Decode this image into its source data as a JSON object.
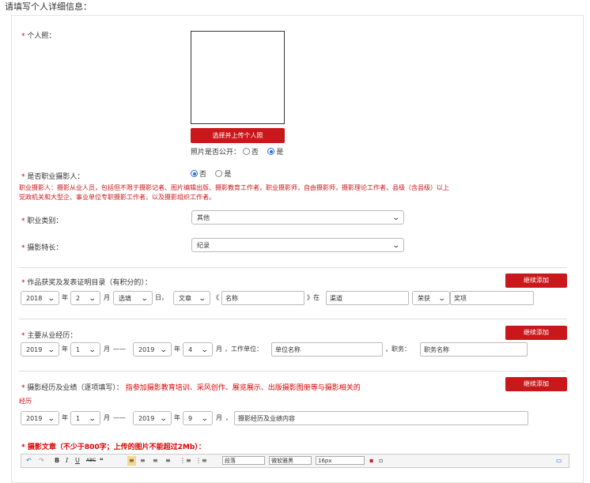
{
  "page": {
    "header": "请填写个人详细信息："
  },
  "photo": {
    "label": "个人照：",
    "required_mark": "*",
    "upload_button": "选择并上传个人照",
    "public_label": "照片是否公开：",
    "option_no": "否",
    "option_yes": "是",
    "selected": "是"
  },
  "professional": {
    "label": "是否职业摄影人：",
    "required_mark": "*",
    "option_no": "否",
    "option_yes": "是",
    "selected": "否",
    "note_line1": "职业摄影人：摄影从业人员，包括但不限于摄影记者、图片编辑出版、摄影教育工作者，职业摄影师，自由摄影师，摄影理论工作者，县级（含县级）以上",
    "note_line2": "党政机关和大型企、事业单位专职摄影工作者，以及摄影组织工作者。"
  },
  "occupation": {
    "label": "职业类别：",
    "required_mark": "*",
    "value": "其他"
  },
  "specialty": {
    "label": "摄影特长：",
    "required_mark": "*",
    "value": "纪录"
  },
  "awards": {
    "label": "作品获奖及发表证明目录（有积分的）：",
    "required_mark": "*",
    "add_button": "继续添加",
    "year": "2018",
    "year_unit": "年",
    "month": "2",
    "month_unit": "月",
    "day": "选填",
    "day_unit": "日，",
    "type": "文章",
    "title_open": "《",
    "title_placeholder": "名称",
    "title_close": "》在",
    "channel_placeholder": "渠道",
    "award_type": "荣获",
    "award_placeholder": "奖项"
  },
  "experience": {
    "label": "主要从业经历：",
    "required_mark": "*",
    "add_button": "继续添加",
    "from_year": "2019",
    "year_unit": "年",
    "from_month": "1",
    "month_unit": "月",
    "dash": "——",
    "to_year": "2019",
    "to_month": "4",
    "unit_label": "，工作单位：",
    "unit_placeholder": "单位名称",
    "title_label": "，职务：",
    "title_placeholder": "职务名称"
  },
  "achievements": {
    "label": "摄影经历及业绩（逐项填写）：",
    "required_mark": "*",
    "hint": "指参加摄影教育培训、采风创作、展览展示、出版摄影图册等与摄影相关的",
    "hint_cont": "经历",
    "add_button": "继续添加",
    "from_year": "2019",
    "year_unit": "年",
    "from_month": "1",
    "month_unit": "月",
    "dash": "——",
    "to_year": "2019",
    "to_month": "9",
    "comma": "，",
    "content_placeholder": "摄影经历及业绩内容"
  },
  "article": {
    "label": "摄影文章（不少于800字；上传的图片不能超过2Mb）：",
    "required_mark": "*",
    "toolbar": {
      "paragraph": "段落",
      "font": "微软雅黑",
      "size": "16px"
    }
  },
  "colors": {
    "accent": "#c9181b",
    "radio": "#2a6ee0"
  }
}
